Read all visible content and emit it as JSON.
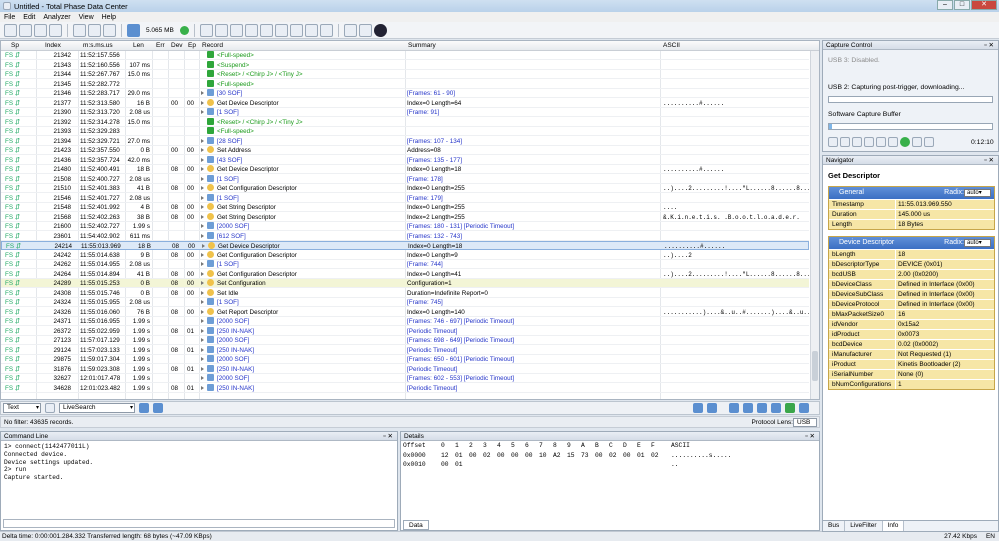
{
  "window": {
    "title": "Untitled - Total Phase Data Center"
  },
  "menu": [
    "File",
    "Edit",
    "Analyzer",
    "View",
    "Help"
  ],
  "toolbar": {
    "buffer_size": "5.065 MB"
  },
  "columns": {
    "sp": "Sp",
    "index": "Index",
    "time": "m:s.ms.us",
    "len": "Len",
    "err": "Err",
    "dev": "Dev",
    "ep": "Ep",
    "record": "Record",
    "summary": "Summary",
    "ascii": "ASCII"
  },
  "rows": [
    {
      "sp": "FS",
      "idx": "21342",
      "time": "11:52:157.556",
      "len": "",
      "err": "",
      "dev": "",
      "ep": "",
      "rec": "<Full-speed>",
      "kind": "green",
      "sum": "",
      "asc": ""
    },
    {
      "sp": "FS",
      "idx": "21343",
      "time": "11:52:160.556",
      "len": "107 ms",
      "err": "",
      "dev": "",
      "ep": "",
      "rec": "<Suspend>",
      "kind": "green",
      "sum": "",
      "asc": ""
    },
    {
      "sp": "FS",
      "idx": "21344",
      "time": "11:52:267.767",
      "len": "15.0 ms",
      "err": "",
      "dev": "",
      "ep": "",
      "rec": "<Reset> / <Chirp J> / <Tiny J>",
      "kind": "green",
      "sum": "",
      "asc": ""
    },
    {
      "sp": "FS",
      "idx": "21345",
      "time": "11:52:282.772",
      "len": "",
      "err": "",
      "dev": "",
      "ep": "",
      "rec": "<Full-speed>",
      "kind": "green",
      "sum": "",
      "asc": ""
    },
    {
      "sp": "FS",
      "idx": "21346",
      "time": "11:52:283.717",
      "len": "29.0 ms",
      "err": "",
      "dev": "",
      "ep": "",
      "rec": "[30 SOF]",
      "kind": "blue",
      "sum": "[Frames: 61 - 90]",
      "sumblue": true,
      "asc": ""
    },
    {
      "sp": "FS",
      "idx": "21377",
      "time": "11:52:313.580",
      "len": "16 B",
      "err": "",
      "dev": "00",
      "ep": "00",
      "rec": "Get Device Descriptor",
      "kind": "desc",
      "sum": "Index=0 Length=64",
      "asc": "..........#......"
    },
    {
      "sp": "FS",
      "idx": "21390",
      "time": "11:52:313.720",
      "len": "2.08 us",
      "err": "",
      "dev": "",
      "ep": "",
      "rec": "[1 SOF]",
      "kind": "blue",
      "sum": "[Frame: 91]",
      "sumblue": true,
      "asc": ""
    },
    {
      "sp": "FS",
      "idx": "21392",
      "time": "11:52:314.278",
      "len": "15.0 ms",
      "err": "",
      "dev": "",
      "ep": "",
      "rec": "<Reset> / <Chirp J> / <Tiny J>",
      "kind": "green",
      "sum": "",
      "asc": ""
    },
    {
      "sp": "FS",
      "idx": "21393",
      "time": "11:52:329.283",
      "len": "",
      "err": "",
      "dev": "",
      "ep": "",
      "rec": "<Full-speed>",
      "kind": "green",
      "sum": "",
      "asc": ""
    },
    {
      "sp": "FS",
      "idx": "21394",
      "time": "11:52:329.721",
      "len": "27.0 ms",
      "err": "",
      "dev": "",
      "ep": "",
      "rec": "[28 SOF]",
      "kind": "blue",
      "sum": "[Frames: 107 - 134]",
      "sumblue": true,
      "asc": ""
    },
    {
      "sp": "FS",
      "idx": "21423",
      "time": "11:52:357.550",
      "len": "0 B",
      "err": "",
      "dev": "00",
      "ep": "00",
      "rec": "Set Address",
      "kind": "desc",
      "sum": "Address=08",
      "asc": ""
    },
    {
      "sp": "FS",
      "idx": "21436",
      "time": "11:52:357.724",
      "len": "42.0 ms",
      "err": "",
      "dev": "",
      "ep": "",
      "rec": "[43 SOF]",
      "kind": "blue",
      "sum": "[Frames: 135 - 177]",
      "sumblue": true,
      "asc": ""
    },
    {
      "sp": "FS",
      "idx": "21480",
      "time": "11:52:400.491",
      "len": "18 B",
      "err": "",
      "dev": "08",
      "ep": "00",
      "rec": "Get Device Descriptor",
      "kind": "desc",
      "sum": "Index=0 Length=18",
      "asc": "..........#......"
    },
    {
      "sp": "FS",
      "idx": "21508",
      "time": "11:52:400.727",
      "len": "2.08 us",
      "err": "",
      "dev": "",
      "ep": "",
      "rec": "[1 SOF]",
      "kind": "blue",
      "sum": "[Frame: 178]",
      "sumblue": true,
      "asc": ""
    },
    {
      "sp": "FS",
      "idx": "21510",
      "time": "11:52:401.383",
      "len": "41 B",
      "err": "",
      "dev": "08",
      "ep": "00",
      "rec": "Get Configuration Descriptor",
      "kind": "desc",
      "sum": "Index=0 Length=255",
      "asc": "..)....2.........!....\"L......8......8....."
    },
    {
      "sp": "FS",
      "idx": "21546",
      "time": "11:52:401.727",
      "len": "2.08 us",
      "err": "",
      "dev": "",
      "ep": "",
      "rec": "[1 SOF]",
      "kind": "blue",
      "sum": "[Frame: 179]",
      "sumblue": true,
      "asc": ""
    },
    {
      "sp": "FS",
      "idx": "21548",
      "time": "11:52:401.992",
      "len": "4 B",
      "err": "",
      "dev": "08",
      "ep": "00",
      "rec": "Get String Descriptor",
      "kind": "desc",
      "sum": "Index=0 Length=255",
      "asc": "...."
    },
    {
      "sp": "FS",
      "idx": "21568",
      "time": "11:52:402.263",
      "len": "38 B",
      "err": "",
      "dev": "08",
      "ep": "00",
      "rec": "Get String Descriptor",
      "kind": "desc",
      "sum": "Index=2 Length=255",
      "asc": "&.K.i.n.e.t.i.s. .B.o.o.t.l.o.a.d.e.r."
    },
    {
      "sp": "FS",
      "idx": "21600",
      "time": "11:52:402.727",
      "len": "1.99 s",
      "err": "",
      "dev": "",
      "ep": "",
      "rec": "[2000 SOF]",
      "kind": "blue",
      "sum": "[Frames: 180 - 131] [Periodic Timeout]",
      "sumblue": true,
      "asc": ""
    },
    {
      "sp": "FS",
      "idx": "23601",
      "time": "11:54:402.902",
      "len": "611 ms",
      "err": "",
      "dev": "",
      "ep": "",
      "rec": "[612 SOF]",
      "kind": "blue",
      "sum": "[Frames: 132 - 743]",
      "sumblue": true,
      "asc": ""
    },
    {
      "sp": "FS",
      "idx": "24214",
      "time": "11:55:013.969",
      "len": "18 B",
      "err": "",
      "dev": "08",
      "ep": "00",
      "rec": "Get Device Descriptor",
      "kind": "desc",
      "sum": "Index=0 Length=18",
      "asc": "..........#......",
      "state": "sel"
    },
    {
      "sp": "FS",
      "idx": "24242",
      "time": "11:55:014.638",
      "len": "9 B",
      "err": "",
      "dev": "08",
      "ep": "00",
      "rec": "Get Configuration Descriptor",
      "kind": "desc",
      "sum": "Index=0 Length=9",
      "asc": "..)....2"
    },
    {
      "sp": "FS",
      "idx": "24262",
      "time": "11:55:014.955",
      "len": "2.08 us",
      "err": "",
      "dev": "",
      "ep": "",
      "rec": "[1 SOF]",
      "kind": "blue",
      "sum": "[Frame: 744]",
      "sumblue": true,
      "asc": ""
    },
    {
      "sp": "FS",
      "idx": "24264",
      "time": "11:55:014.894",
      "len": "41 B",
      "err": "",
      "dev": "08",
      "ep": "00",
      "rec": "Get Configuration Descriptor",
      "kind": "desc",
      "sum": "Index=0 Length=41",
      "asc": "..)....2.........!....\"L......8......8....."
    },
    {
      "sp": "FS",
      "idx": "24289",
      "time": "11:55:015.253",
      "len": "0 B",
      "err": "",
      "dev": "08",
      "ep": "00",
      "rec": "Set Configuration",
      "kind": "desc",
      "sum": "Configuration=1",
      "asc": "",
      "state": "hl"
    },
    {
      "sp": "FS",
      "idx": "24308",
      "time": "11:55:015.746",
      "len": "0 B",
      "err": "",
      "dev": "08",
      "ep": "00",
      "rec": "Set Idle",
      "kind": "desc",
      "sum": "Duration=Indefinite Report=0",
      "asc": ""
    },
    {
      "sp": "FS",
      "idx": "24324",
      "time": "11:55:015.955",
      "len": "2.08 us",
      "err": "",
      "dev": "",
      "ep": "",
      "rec": "[1 SOF]",
      "kind": "blue",
      "sum": "[Frame: 745]",
      "sumblue": true,
      "asc": ""
    },
    {
      "sp": "FS",
      "idx": "24326",
      "time": "11:55:016.060",
      "len": "76 B",
      "err": "",
      "dev": "08",
      "ep": "00",
      "rec": "Get Report Descriptor",
      "kind": "desc",
      "sum": "Index=0 Length=140",
      "asc": "...........)....&..u..#.......)....&..u..#..."
    },
    {
      "sp": "FS",
      "idx": "24371",
      "time": "11:55:016.955",
      "len": "1.99 s",
      "err": "",
      "dev": "",
      "ep": "",
      "rec": "[2000 SOF]",
      "kind": "blue",
      "sum": "[Frames: 746 - 697] [Periodic Timeout]",
      "sumblue": true,
      "asc": ""
    },
    {
      "sp": "FS",
      "idx": "26372",
      "time": "11:55:022.959",
      "len": "1.99 s",
      "err": "",
      "dev": "08",
      "ep": "01",
      "rec": "[250 IN-NAK]",
      "kind": "blue",
      "sum": "[Periodic Timeout]",
      "sumblue": true,
      "asc": ""
    },
    {
      "sp": "FS",
      "idx": "27123",
      "time": "11:57:017.129",
      "len": "1.99 s",
      "err": "",
      "dev": "",
      "ep": "",
      "rec": "[2000 SOF]",
      "kind": "blue",
      "sum": "[Frames: 698 - 649] [Periodic Timeout]",
      "sumblue": true,
      "asc": ""
    },
    {
      "sp": "FS",
      "idx": "29124",
      "time": "11:57:023.133",
      "len": "1.99 s",
      "err": "",
      "dev": "08",
      "ep": "01",
      "rec": "[250 IN-NAK]",
      "kind": "blue",
      "sum": "[Periodic Timeout]",
      "sumblue": true,
      "asc": ""
    },
    {
      "sp": "FS",
      "idx": "29875",
      "time": "11:59:017.304",
      "len": "1.99 s",
      "err": "",
      "dev": "",
      "ep": "",
      "rec": "[2000 SOF]",
      "kind": "blue",
      "sum": "[Frames: 650 - 601] [Periodic Timeout]",
      "sumblue": true,
      "asc": ""
    },
    {
      "sp": "FS",
      "idx": "31876",
      "time": "11:59:023.308",
      "len": "1.99 s",
      "err": "",
      "dev": "08",
      "ep": "01",
      "rec": "[250 IN-NAK]",
      "kind": "blue",
      "sum": "[Periodic Timeout]",
      "sumblue": true,
      "asc": ""
    },
    {
      "sp": "FS",
      "idx": "32627",
      "time": "12:01:017.478",
      "len": "1.99 s",
      "err": "",
      "dev": "",
      "ep": "",
      "rec": "[2000 SOF]",
      "kind": "blue",
      "sum": "[Frames: 602 - 553] [Periodic Timeout]",
      "sumblue": true,
      "asc": ""
    },
    {
      "sp": "FS",
      "idx": "34628",
      "time": "12:01:023.482",
      "len": "1.99 s",
      "err": "",
      "dev": "08",
      "ep": "01",
      "rec": "[250 IN-NAK]",
      "kind": "blue",
      "sum": "[Periodic Timeout]",
      "sumblue": true,
      "asc": ""
    }
  ],
  "filterbar": {
    "mode": "Text",
    "search_placeholder": "LiveSearch",
    "protocol_label": "Protocol Lens:",
    "protocol_value": "USB"
  },
  "status_line": "No filter: 43635 records.",
  "command_line": {
    "title": "Command Line",
    "lines": [
      "1> connect(1142477011L)",
      "Connected device.",
      "Device settings updated.",
      "2> run",
      "Capture started."
    ]
  },
  "details": {
    "title": "Details",
    "header": [
      "Offset",
      "0",
      "1",
      "2",
      "3",
      "4",
      "5",
      "6",
      "7",
      "8",
      "9",
      "A",
      "B",
      "C",
      "D",
      "E",
      "F",
      "ASCII"
    ],
    "rows": [
      {
        "offset": "0x0000",
        "bytes": [
          "12",
          "01",
          "00",
          "02",
          "00",
          "00",
          "00",
          "10",
          "A2",
          "15",
          "73",
          "00",
          "02",
          "00",
          "01",
          "02"
        ],
        "ascii": "..........s....."
      },
      {
        "offset": "0x0010",
        "bytes": [
          "00",
          "01"
        ],
        "ascii": ".."
      }
    ],
    "tab": "Data"
  },
  "statusbar": {
    "text": "Delta time: 0:00:001.284.332   Transferred length: 68 bytes (~47.09 KBps)",
    "rate": "27.42 Kbps",
    "lang": "EN"
  },
  "capture": {
    "title": "Capture Control",
    "usb3": "USB 3: Disabled.",
    "usb2": "USB 2: Capturing post-trigger, downloading...",
    "buffer_label": "Software Capture Buffer",
    "usb2_progress": 0.0,
    "buffer_progress": 0.02,
    "elapsed": "0:12:10"
  },
  "navigator": {
    "title": "Navigator",
    "heading": "Get Descriptor",
    "general": {
      "label": "General",
      "radix": "Radix:",
      "radix_value": "auto",
      "items": [
        {
          "k": "Timestamp",
          "v": "11:55.013.969.550"
        },
        {
          "k": "Duration",
          "v": "145.000 us"
        },
        {
          "k": "Length",
          "v": "18 Bytes"
        }
      ]
    },
    "device": {
      "label": "Device Descriptor",
      "radix": "Radix:",
      "radix_value": "auto",
      "items": [
        {
          "k": "bLength",
          "v": "18"
        },
        {
          "k": "bDescriptorType",
          "v": "DEVICE (0x01)"
        },
        {
          "k": "bcdUSB",
          "v": "2.00 (0x0200)"
        },
        {
          "k": "bDeviceClass",
          "v": "Defined in Interface (0x00)"
        },
        {
          "k": "bDeviceSubClass",
          "v": "Defined in Interface (0x00)"
        },
        {
          "k": "bDeviceProtocol",
          "v": "Defined in Interface (0x00)"
        },
        {
          "k": "bMaxPacketSize0",
          "v": "16"
        },
        {
          "k": "idVendor",
          "v": "0x15a2"
        },
        {
          "k": "idProduct",
          "v": "0x0073"
        },
        {
          "k": "bcdDevice",
          "v": "0.02 (0x0002)"
        },
        {
          "k": "iManufacturer",
          "v": "Not Requested (1)"
        },
        {
          "k": "iProduct",
          "v": "Kinetis Bootloader (2)"
        },
        {
          "k": "iSerialNumber",
          "v": "None (0)"
        },
        {
          "k": "bNumConfigurations",
          "v": "1"
        }
      ]
    },
    "tabs": [
      "Bus",
      "LiveFilter",
      "Info"
    ]
  }
}
